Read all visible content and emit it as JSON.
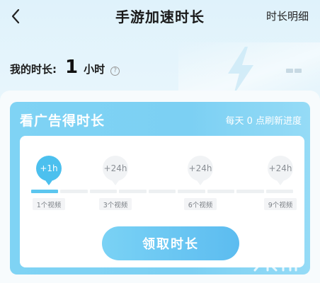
{
  "header": {
    "title": "手游加速时长",
    "detail_label": "时长明细",
    "back_icon": "chevron-left-icon"
  },
  "summary": {
    "label": "我的时长:",
    "value": "1",
    "unit": "小时",
    "help_icon": "question-circle-icon"
  },
  "ad_card": {
    "title": "看广告得时长",
    "note": "每天 0 点刷新进度",
    "accent": "#4cc0ee",
    "progress_fraction": 0.09,
    "steps": [
      {
        "badge": "+1h",
        "label": "1个视频",
        "active": true
      },
      {
        "badge": "+24h",
        "label": "3个视频",
        "active": false
      },
      {
        "badge": "+24h",
        "label": "6个视频",
        "active": false
      },
      {
        "badge": "+24h",
        "label": "9个视频",
        "active": false
      }
    ],
    "claim_label": "领取时长"
  }
}
